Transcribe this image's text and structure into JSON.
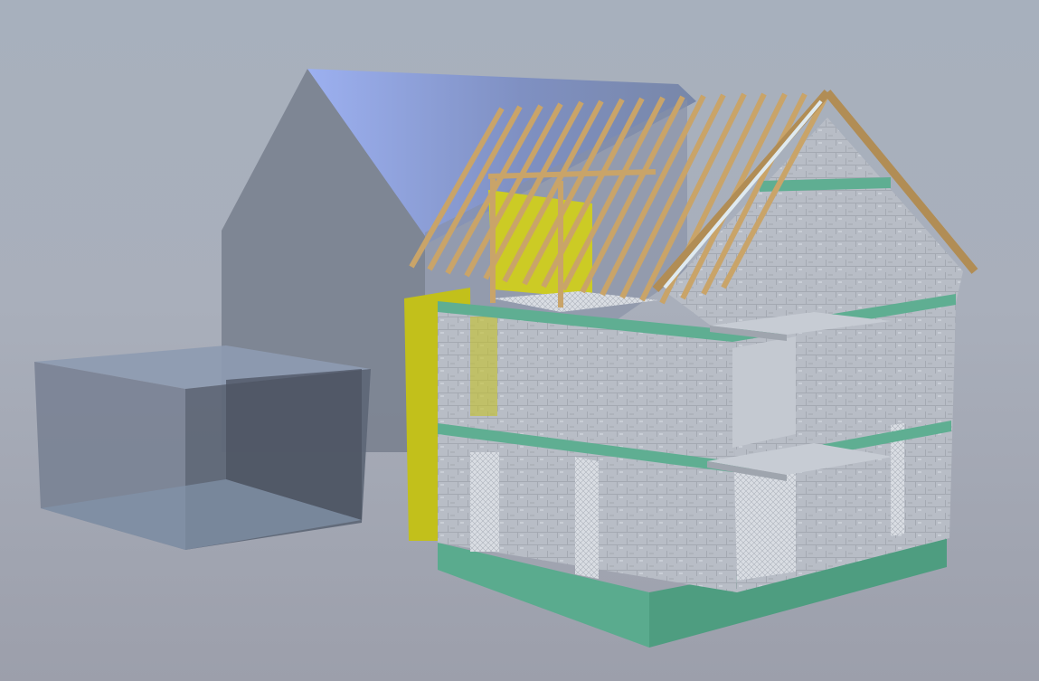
{
  "viewport": {
    "background_top": "#a7b0bd",
    "background_bottom": "#9c9fab"
  },
  "scene": {
    "objects": [
      "ghost-main-house",
      "ghost-garage",
      "yellow-rear-wall",
      "masonry-house-under-construction",
      "timber-roof-rafters"
    ],
    "colors": {
      "ghost_blue": "#7c8aa8",
      "ghost_roof_highlight": "#9aaeea",
      "masonry_grey": "#b9bec6",
      "slab_green": "#5fae92",
      "yellow_wall": "#c7c51a",
      "timber": "#c9a469"
    }
  }
}
